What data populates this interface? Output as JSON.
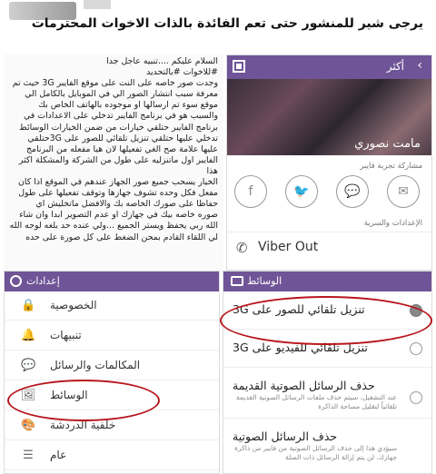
{
  "post": {
    "caption": "يرجى شير للمنشور حتى تعم الفائدة بالذات الاخوات المحترمات"
  },
  "article": {
    "lines": [
      "السلام عليكم ....تنبيه عاجل جدا",
      "#للاخوات #بالتحديد",
      "وجدت صور خاصه على النت على موقع الفايبر 3G حيث تم",
      "معرفة سبب انتشار الصور الي في الموبايل بالكامل الي",
      "موقع سوء تم ارسالها او موجوده بالهاتف الخاص بك",
      "والسبب هو في برنامج الفايبر تدخلي على الاعدادات في",
      "برنامج الفايبر حتلقي خيارات من ضمن الخيارات الوسائط",
      "تدخلي عليها حتلقي تنزيل تلقائي للصور على 3Gحتلقي",
      "عليها علامة صح الغي تفعيلها لان هيا مفعله من البرنامج",
      "الفايبر اول ماتنزليه على طول من الشركة والمشكلة اكثر هذا",
      "الخيار يسحب جميع صور الجهاز عندهم في الموقع اذا كان",
      "مفعل فكل وحده تشوف جهازها وتوقف تفعيلها على طول",
      "حفاظا على صورك الخاصه بك والافضل ماتخليش اي",
      "صوره خاصه بيك في جهازك او عدم التصوير ابدا وان شاء",
      "الله ربي يحفظ ويستر الجميع ...ولي عنده حد بلغه لوجه الله",
      "لي اللقاء القادم بمحن الضغط على كل صورة على حده"
    ]
  },
  "viber_more": {
    "title": "أكثر",
    "profile_name": "مامت نصوري",
    "share_label": "مشاركة تجربة فايبر",
    "share_icons": [
      "facebook-icon",
      "twitter-icon",
      "message-icon",
      "email-icon"
    ],
    "share_glyphs": [
      "f",
      "🐦",
      "💬",
      "✉"
    ],
    "settings_label": "الإعدادات والسرية",
    "viber_out_label": "Viber Out"
  },
  "settings": {
    "title": "إعدادات",
    "items": [
      {
        "label": "الخصوصية",
        "icon": "lock-icon",
        "glyph": "🔒"
      },
      {
        "label": "تنبيهات",
        "icon": "bell-icon",
        "glyph": "🔔"
      },
      {
        "label": "المكالمات والرسائل",
        "icon": "chat-icon",
        "glyph": "💬"
      },
      {
        "label": "الوسائط",
        "icon": "image-icon",
        "glyph": "🖼"
      },
      {
        "label": "خلفية الدردشة",
        "icon": "brush-icon",
        "glyph": "🎨"
      },
      {
        "label": "عام",
        "icon": "list-icon",
        "glyph": "☰"
      }
    ]
  },
  "media": {
    "title": "الوسائط",
    "items": [
      {
        "label": "تنزيل تلقائي للصور على 3G",
        "checked": true,
        "desc": ""
      },
      {
        "label": "تنزيل تلقائي للفيديو على 3G",
        "checked": false,
        "desc": ""
      },
      {
        "label": "حذف الرسائل الصوتية القديمة",
        "checked": false,
        "desc": "عند التشغيل، سيتم حذف ملفات الرسائل الصوتية القديمة تلقائياً لتقليل مساحة الذاكرة"
      },
      {
        "label": "حذف الرسائل الصوتية",
        "checked": false,
        "desc": "سيؤدي هذا إلى حذف الرسائل الصوتية من فايبر من ذاكرة جهازك. لن يتم إزالة الرسائل ذات الصلة"
      }
    ]
  },
  "colors": {
    "viber_purple": "#6f5597",
    "annotation_red": "#b8161c"
  }
}
